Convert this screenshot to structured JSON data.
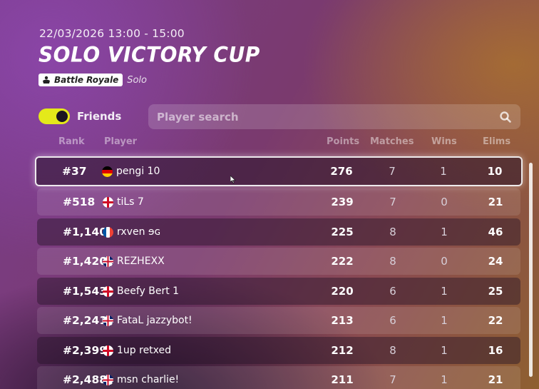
{
  "event": {
    "date": "22/03/2026 13:00 - 15:00",
    "title": "SOLO VICTORY CUP",
    "mode": "Battle Royale",
    "submode": "Solo"
  },
  "filters": {
    "friends_label": "Friends",
    "friends_on": true,
    "search_placeholder": "Player search"
  },
  "columns": {
    "rank": "Rank",
    "player": "Player",
    "points": "Points",
    "matches": "Matches",
    "wins": "Wins",
    "elims": "Elims"
  },
  "rows": [
    {
      "rank": "#37",
      "player": "pengi 10",
      "flag": "germany",
      "points": "276",
      "matches": "7",
      "wins": "1",
      "elims": "10"
    },
    {
      "rank": "#518",
      "player": "tiLs 7",
      "flag": "england",
      "points": "239",
      "matches": "7",
      "wins": "0",
      "elims": "21"
    },
    {
      "rank": "#1,140",
      "player": "rxven ɘɢ",
      "flag": "france",
      "points": "225",
      "matches": "8",
      "wins": "1",
      "elims": "46"
    },
    {
      "rank": "#1,420",
      "player": "REZHEXX",
      "flag": "uk",
      "points": "222",
      "matches": "8",
      "wins": "0",
      "elims": "24"
    },
    {
      "rank": "#1,543",
      "player": "Beefy Bert 1",
      "flag": "england",
      "points": "220",
      "matches": "6",
      "wins": "1",
      "elims": "25"
    },
    {
      "rank": "#2,241",
      "player": "FataL jazzybot!",
      "flag": "uk",
      "points": "213",
      "matches": "6",
      "wins": "1",
      "elims": "22"
    },
    {
      "rank": "#2,399",
      "player": "1up retxed",
      "flag": "england",
      "points": "212",
      "matches": "8",
      "wins": "1",
      "elims": "16"
    },
    {
      "rank": "#2,488",
      "player": "msn charlie!",
      "flag": "uk",
      "points": "211",
      "matches": "7",
      "wins": "1",
      "elims": "21"
    }
  ],
  "colors": {
    "toggle_on": "#e4e91a",
    "row_highlight_border": "#ffffff"
  }
}
